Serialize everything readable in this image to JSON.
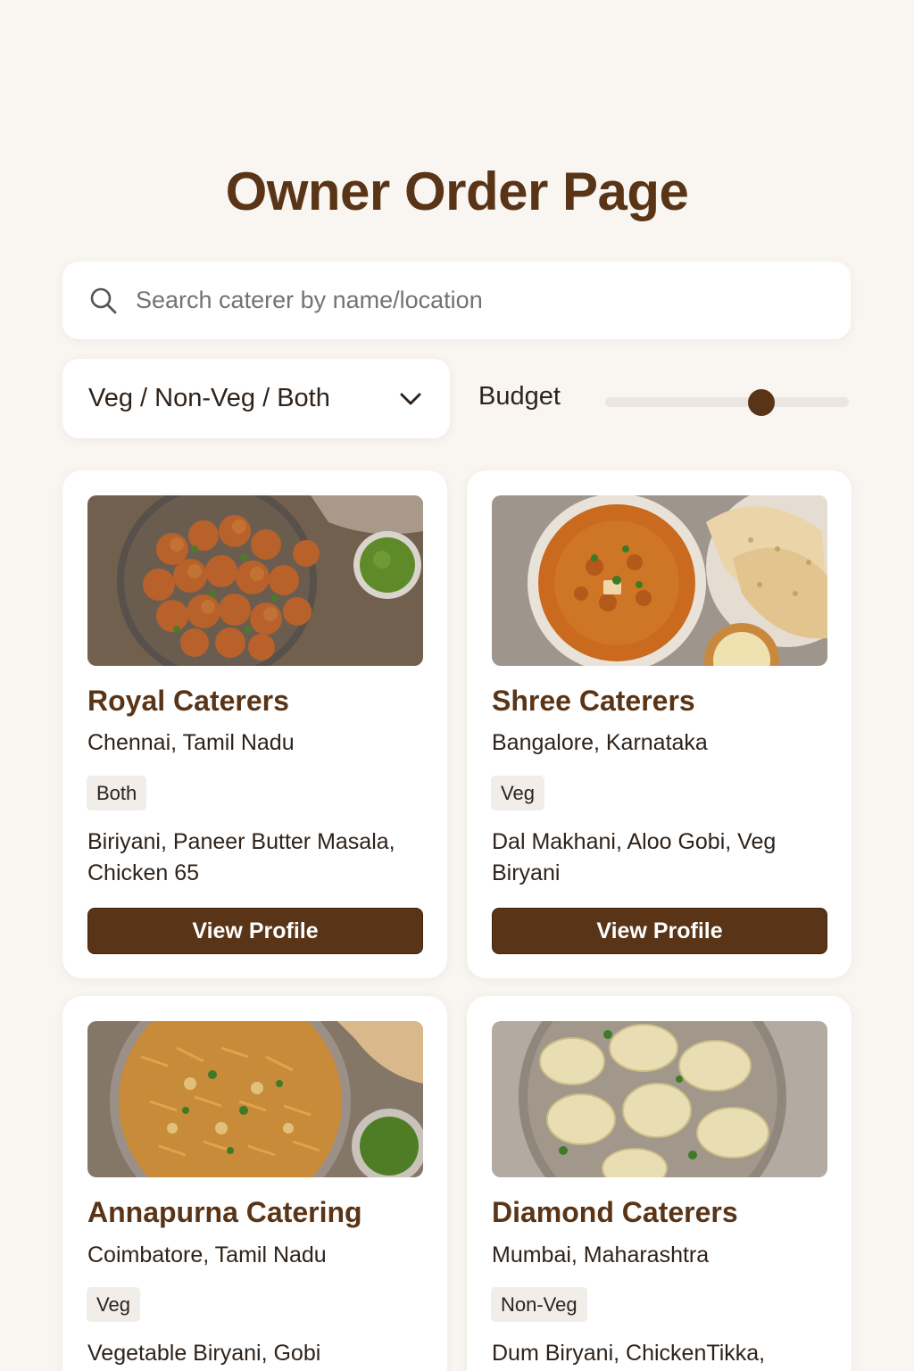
{
  "page": {
    "title": "Owner Order Page"
  },
  "search": {
    "placeholder": "Search caterer by name/location",
    "value": "",
    "icon": "search-icon"
  },
  "filters": {
    "diet_type": {
      "selected": "Veg / Non-Veg / Both",
      "icon": "chevron-down-icon"
    },
    "budget": {
      "label": "Budget",
      "value_fraction": 0.64
    }
  },
  "caterers": [
    {
      "name": "Royal Caterers",
      "location": "Chennai, Tamil Nadu",
      "type": "Both",
      "dishes": "Biriyani, Paneer Butter Masala, Chicken 65",
      "button_label": "View Profile",
      "image": "chicken-65-photo"
    },
    {
      "name": "Shree Caterers",
      "location": "Bangalore, Karnataka",
      "type": "Veg",
      "dishes": "Dal Makhani, Aloo Gobi, Veg Biryani",
      "button_label": "View Profile",
      "image": "curry-and-naan-photo"
    },
    {
      "name": "Annapurna Catering",
      "location": "Coimbatore, Tamil Nadu",
      "type": "Veg",
      "dishes": "Vegetable Biryani, Gobi",
      "image": "vegetable-biryani-photo"
    },
    {
      "name": "Diamond Caterers",
      "location": "Mumbai, Maharashtra",
      "type": "Non-Veg",
      "dishes": "Dum Biryani, ChickenTikka,",
      "image": "momos-photo"
    }
  ],
  "colors": {
    "background": "#f9f6f2",
    "accent": "#5a3416",
    "card": "#ffffff",
    "badge": "#f1ede8"
  }
}
